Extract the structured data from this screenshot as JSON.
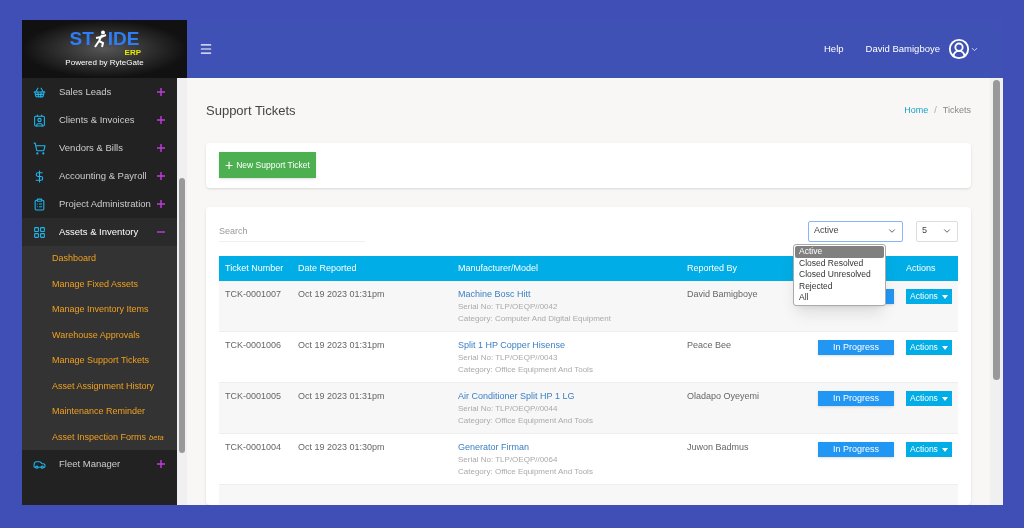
{
  "logo": {
    "left": "ST",
    "right": "IDE",
    "suffix": "ERP",
    "tagline": "Powered by RyteGate"
  },
  "sidebar": {
    "items": [
      {
        "label": "Sales Leads",
        "expanded": false
      },
      {
        "label": "Clients & Invoices",
        "expanded": false
      },
      {
        "label": "Vendors & Bills",
        "expanded": false
      },
      {
        "label": "Accounting & Payroll",
        "expanded": false
      },
      {
        "label": "Project Administration",
        "expanded": false
      },
      {
        "label": "Assets & Inventory",
        "expanded": true,
        "children": [
          {
            "label": "Dashboard"
          },
          {
            "label": "Manage Fixed Assets"
          },
          {
            "label": "Manage Inventory Items"
          },
          {
            "label": "Warehouse Approvals"
          },
          {
            "label": "Manage Support Tickets"
          },
          {
            "label": "Asset Assignment History"
          },
          {
            "label": "Maintenance Reminder"
          },
          {
            "label": "Asset Inspection Forms",
            "badge": "beta"
          }
        ]
      },
      {
        "label": "Fleet Manager",
        "expanded": false
      }
    ]
  },
  "header": {
    "help": "Help",
    "user": "David Bamigboye"
  },
  "page": {
    "title": "Support Tickets",
    "breadcrumb": [
      "Home",
      "Tickets"
    ],
    "separator": "/"
  },
  "new_button": {
    "plus": "+",
    "label": "New Support Ticket"
  },
  "search": {
    "placeholder": "Search"
  },
  "status_filter": {
    "value": "Active",
    "options": [
      {
        "label": "Active",
        "selected": true
      },
      {
        "label": "Closed Resolved",
        "selected": false
      },
      {
        "label": "Closed Unresolved",
        "selected": false
      },
      {
        "label": "Rejected",
        "selected": false
      },
      {
        "label": "All",
        "selected": false
      }
    ]
  },
  "page_size": {
    "value": "5"
  },
  "table": {
    "columns": [
      "Ticket Number",
      "Date Reported",
      "Manufacturer/Model",
      "Reported By",
      "",
      "Actions"
    ],
    "rows": [
      {
        "ticket": "TCK-0001007",
        "date": "Oct 19 2023 01:31pm",
        "model": "Machine Bosc Hitt",
        "serial": "Serial No: TLP/OEQP//0042",
        "category": "Category: Computer And Digital Equipment",
        "reported_by": "David Bamigboye",
        "actions": "Actions"
      },
      {
        "ticket": "TCK-0001006",
        "date": "Oct 19 2023 01:31pm",
        "model": "Split 1 HP Copper Hisense",
        "serial": "Serial No: TLP/OEQP//0043",
        "category": "Category: Office Equipment And Tools",
        "reported_by": "Peace Bee",
        "status": "In Progress",
        "actions": "Actions"
      },
      {
        "ticket": "TCK-0001005",
        "date": "Oct 19 2023 01:31pm",
        "model": "Air Conditioner Split HP 1 LG",
        "serial": "Serial No: TLP/OEQP//0044",
        "category": "Category: Office Equipment And Tools",
        "reported_by": "Oladapo Oyeyemi",
        "status": "In Progress",
        "actions": "Actions"
      },
      {
        "ticket": "TCK-0001004",
        "date": "Oct 19 2023 01:30pm",
        "model": "Generator Firman",
        "serial": "Serial No: TLP/OEQP//0064",
        "category": "Category: Office Equipment And Tools",
        "reported_by": "Juwon Badmus",
        "status": "In Progress",
        "actions": "Actions"
      }
    ]
  }
}
